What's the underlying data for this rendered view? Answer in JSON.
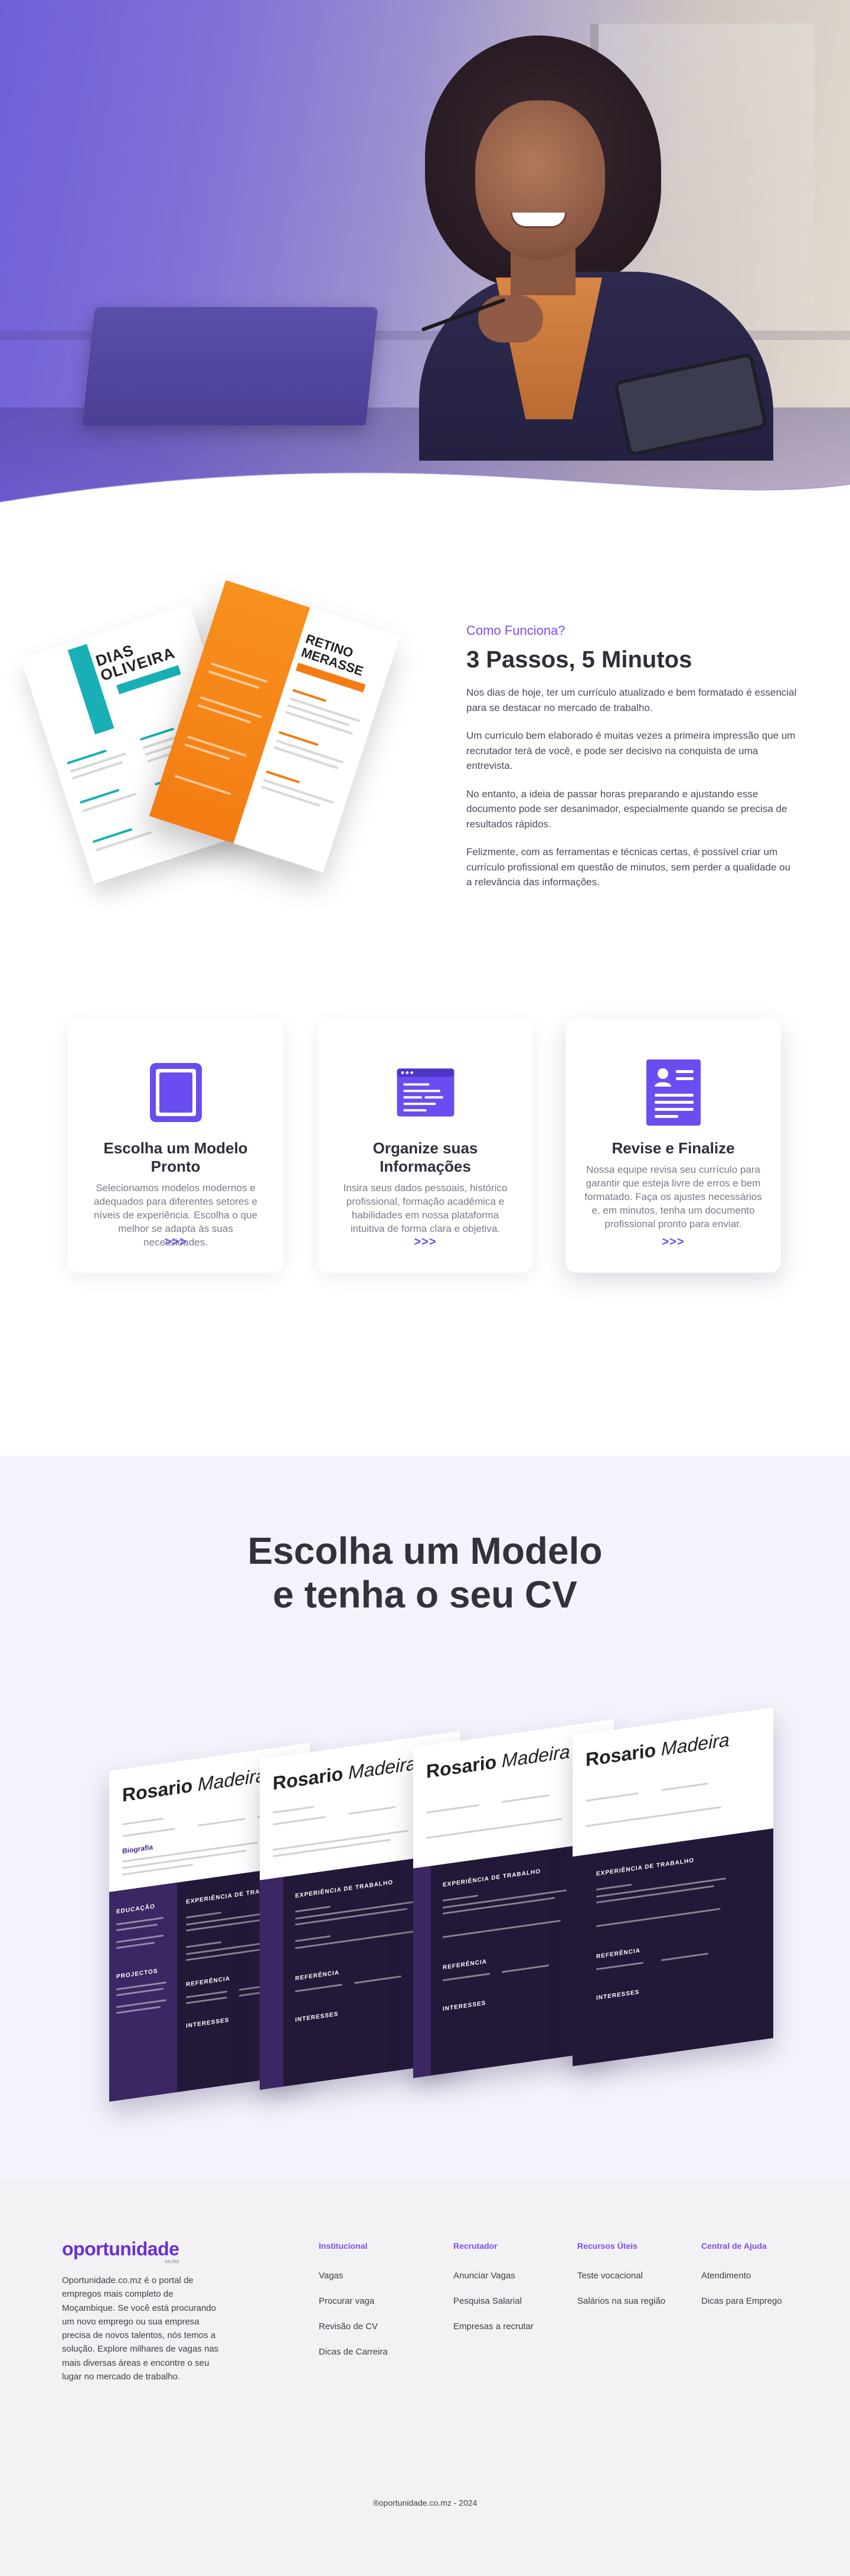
{
  "how": {
    "eyebrow": "Como Funciona?",
    "title": "3 Passos, 5 Minutos",
    "paragraphs": [
      "Nos dias de hoje, ter um currículo atualizado e bem formatado é essencial para se destacar no mercado de trabalho.",
      "Um currículo bem elaborado é muitas vezes a primeira impressão que um recrutador terá de você, e pode ser decisivo na conquista de uma entrevista.",
      "No entanto, a ideia de passar horas preparando e ajustando esse documento pode ser desanimador, especialmente quando se precisa de resultados rápidos.",
      "Felizmente, com as ferramentas e técnicas certas, é possível criar um currículo profissional em questão de minutos, sem perder a qualidade ou a relevância das informações."
    ],
    "resume_a_name": "DIAS OLIVEIRA",
    "resume_b_name": "RETINO MERASSE"
  },
  "steps": [
    {
      "title": "Escolha um Modelo Pronto",
      "text": "Selecionamos modelos modernos e adequados para diferentes setores e níveis de experiência. Escolha o que melhor se adapta às suas necessidades.",
      "arrows": ">>>",
      "icon": "template-icon"
    },
    {
      "title": "Organize suas Informações",
      "text": "Insira seus dados pessoais, histórico profissional, formação acadêmica e habilidades em nossa plataforma intuitiva de forma clara e objetiva.",
      "arrows": ">>>",
      "icon": "window-form-icon"
    },
    {
      "title": "Revise e Finalize",
      "text": "Nossa equipe revisa seu currículo para garantir que esteja livre de erros e bem formatado. Faça os ajustes necessários e, em minutos, tenha um documento profissional pronto para enviar.",
      "arrows": ">>>",
      "icon": "resume-icon"
    }
  ],
  "templates": {
    "title_line1": "Escolha um Modelo",
    "title_line2": "e tenha o seu CV",
    "cv_first": "Rosario",
    "cv_last": "Madeira",
    "cv_section_experience": "EXPERIÊNCIA DE TRABALHO",
    "cv_section_reference": "REFERÊNCIA",
    "cv_section_interests": "INTERESSES",
    "cv_section_education": "EDUCAÇÃO",
    "cv_section_projects": "PROJECTOS",
    "cv_section_bio": "Biografia"
  },
  "footer": {
    "logo": "oportunidade",
    "logo_sub": "co.mz",
    "about": "Oportunidade.co.mz é o portal de empregos mais completo de Moçambique. Se você está procurando um novo emprego ou sua empresa precisa de novos talentos, nós temos a solução. Explore milhares de vagas nas mais diversas áreas e encontre o seu lugar no mercado de trabalho.",
    "columns": [
      {
        "title": "Institucional",
        "links": [
          "Vagas",
          "Procurar vaga",
          "Revisão de CV",
          "Dicas de Carreira"
        ]
      },
      {
        "title": "Recrutador",
        "links": [
          "Anunciar Vagas",
          "Pesquisa Salarial",
          "Empresas a recrutar"
        ]
      },
      {
        "title": "Recursos Úteis",
        "links": [
          "Teste vocacional",
          "Salários na sua região"
        ]
      },
      {
        "title": "Central de Ajuda",
        "links": [
          "Atendimento",
          "Dicas para Emprego"
        ]
      }
    ],
    "copyright": "®oportunidade.co.mz - 2024"
  },
  "colors": {
    "accent": "#7a4ff0",
    "icon_purple": "#6a4cf0",
    "hero_purple": "#6f5fd9",
    "resume_teal": "#19b0b5",
    "resume_orange": "#f47c13",
    "cv_dark": "#231838"
  }
}
